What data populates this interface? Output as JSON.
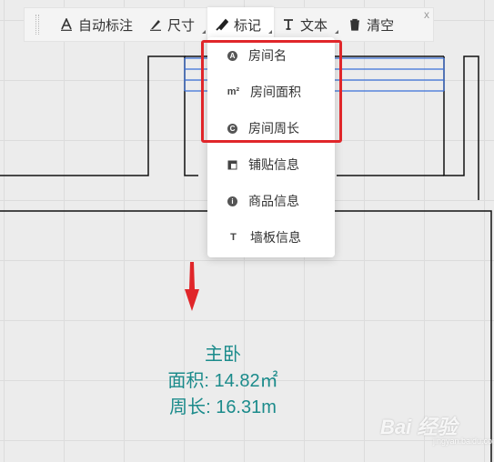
{
  "toolbar": {
    "items": [
      {
        "label": "自动标注",
        "icon": "auto-annotate-icon"
      },
      {
        "label": "尺寸",
        "icon": "ruler-icon"
      },
      {
        "label": "标记",
        "icon": "marker-icon"
      },
      {
        "label": "文本",
        "icon": "text-icon"
      },
      {
        "label": "清空",
        "icon": "trash-icon"
      }
    ],
    "close_label": "x"
  },
  "dropdown": {
    "items": [
      {
        "label": "房间名",
        "icon": "A",
        "icon_name": "room-name-icon"
      },
      {
        "label": "房间面积",
        "icon": "m²",
        "icon_name": "area-icon"
      },
      {
        "label": "房间周长",
        "icon": "C",
        "icon_name": "perimeter-icon"
      },
      {
        "label": "铺贴信息",
        "icon": "tile-icon"
      },
      {
        "label": "商品信息",
        "icon": "i",
        "icon_name": "info-icon"
      },
      {
        "label": "墙板信息",
        "icon": "T",
        "icon_name": "wall-panel-icon"
      }
    ]
  },
  "room": {
    "name": "主卧",
    "area": "面积: 14.82㎡",
    "perimeter": "周长: 16.31m"
  },
  "watermark": {
    "text": "Bai 经验",
    "sub": "jingyan.baidu.com"
  },
  "colors": {
    "highlight": "#e0262a",
    "room_text": "#1b8b8b",
    "arrow": "#e0262a",
    "blue_lines": "#3a6fd8"
  }
}
